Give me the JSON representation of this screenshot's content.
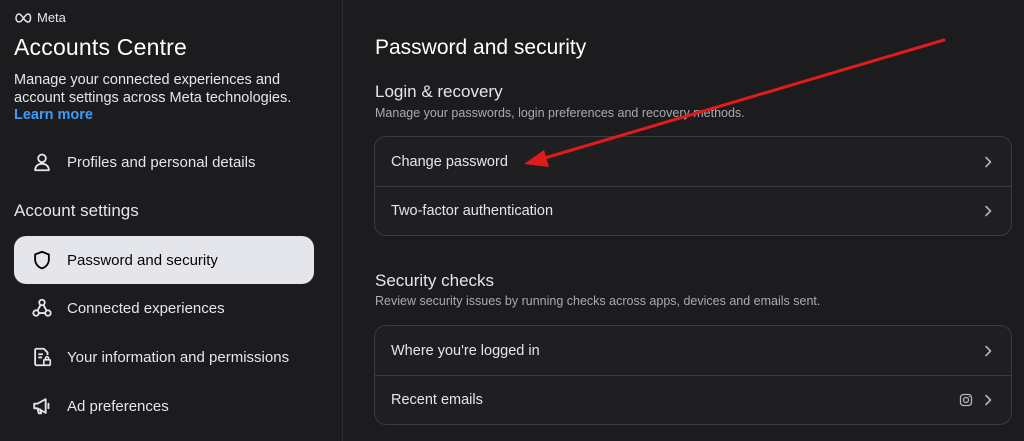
{
  "brand": {
    "name": "Meta"
  },
  "sidebar": {
    "title": "Accounts Centre",
    "description": "Manage your connected experiences and account settings across Meta technologies.",
    "learn_more": "Learn more",
    "profiles_item": {
      "label": "Profiles and personal details",
      "icon": "person-icon"
    },
    "section_label": "Account settings",
    "items": [
      {
        "label": "Password and security",
        "icon": "shield-icon",
        "active": true
      },
      {
        "label": "Connected experiences",
        "icon": "nodes-icon",
        "active": false
      },
      {
        "label": "Your information and permissions",
        "icon": "document-lock-icon",
        "active": false
      },
      {
        "label": "Ad preferences",
        "icon": "megaphone-icon",
        "active": false
      }
    ]
  },
  "main": {
    "title": "Password and security",
    "login_section": {
      "title": "Login & recovery",
      "subtitle": "Manage your passwords, login preferences and recovery methods.",
      "rows": [
        {
          "label": "Change password"
        },
        {
          "label": "Two-factor authentication"
        }
      ]
    },
    "security_section": {
      "title": "Security checks",
      "subtitle": "Review security issues by running checks across apps, devices and emails sent.",
      "rows": [
        {
          "label": "Where you're logged in"
        },
        {
          "label": "Recent emails",
          "badge_icon": "instagram-icon"
        }
      ]
    }
  },
  "colors": {
    "accent": "#3f9bf5",
    "annotation_arrow": "#e01b1b",
    "active_bg": "#e4e6eb"
  }
}
